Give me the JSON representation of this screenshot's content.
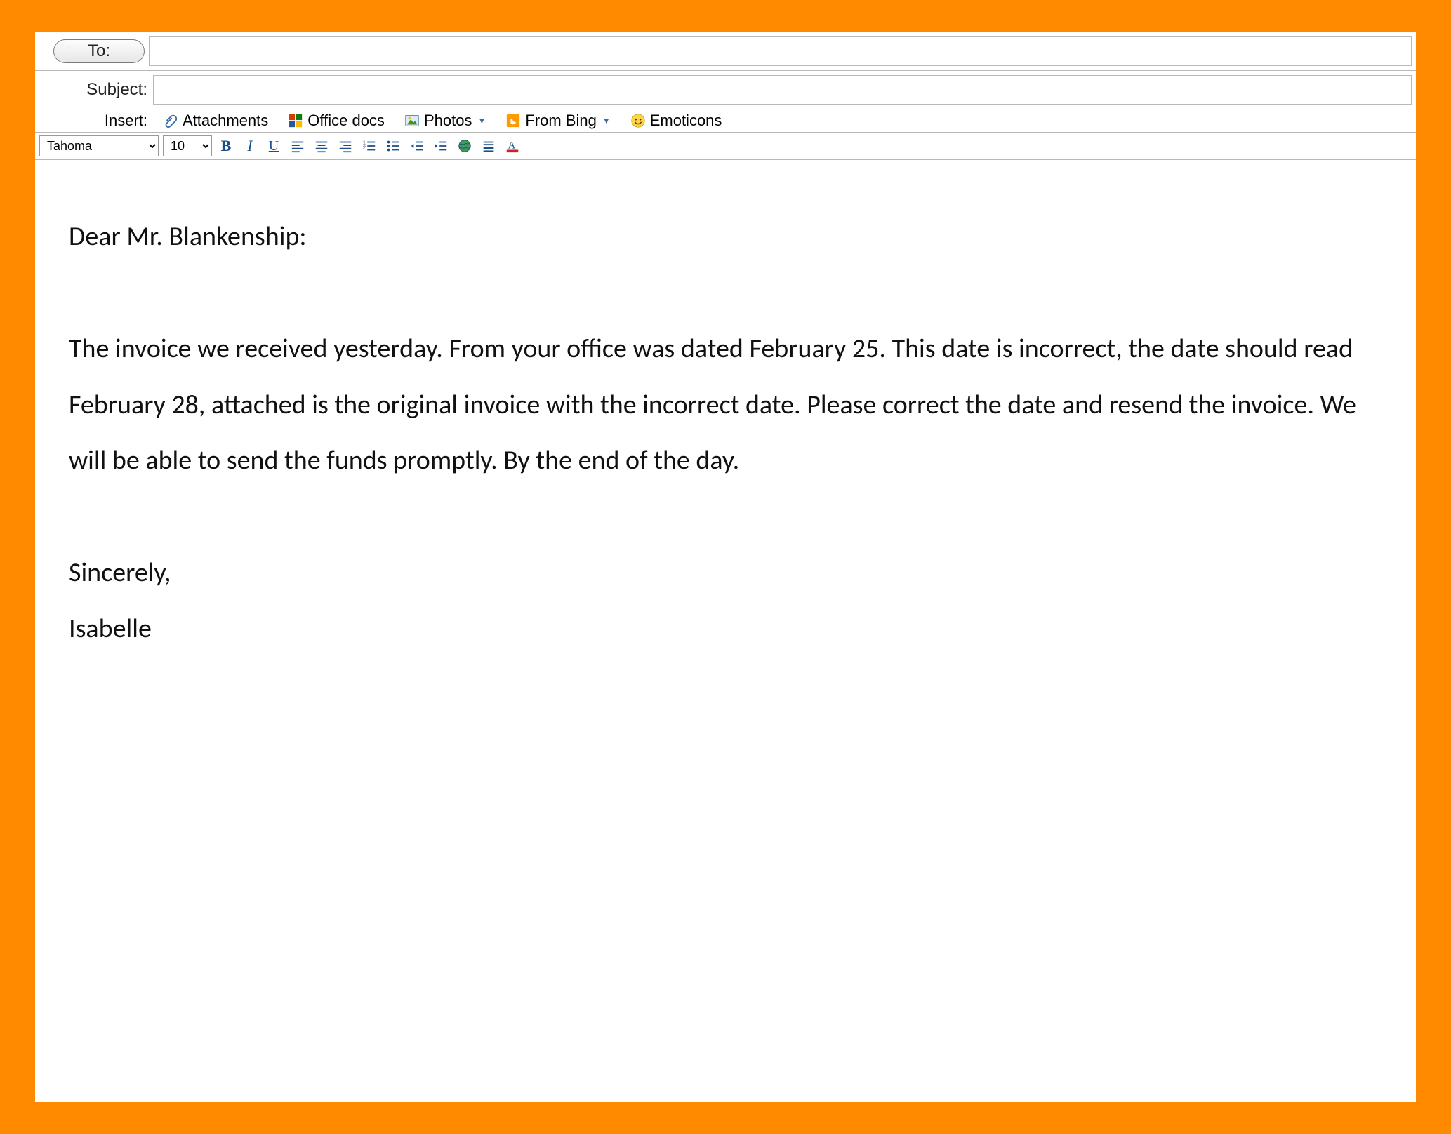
{
  "fields": {
    "to_label": "To:",
    "to_value": "",
    "subject_label": "Subject:",
    "subject_value": ""
  },
  "insert": {
    "label": "Insert:",
    "attachments": "Attachments",
    "office_docs": "Office docs",
    "photos": "Photos",
    "from_bing": "From Bing",
    "emoticons": "Emoticons"
  },
  "fmt": {
    "font": "Tahoma",
    "size": "10"
  },
  "body": {
    "greeting": "Dear Mr. Blankenship:",
    "para": "The invoice we received yesterday. From your office was dated February 25.  This date is incorrect, the date should read February 28, attached is the original invoice with the incorrect date. Please correct the date and resend the invoice. We will be able to send the funds promptly. By the end of the day.",
    "sign1": "Sincerely,",
    "sign2": "Isabelle"
  }
}
